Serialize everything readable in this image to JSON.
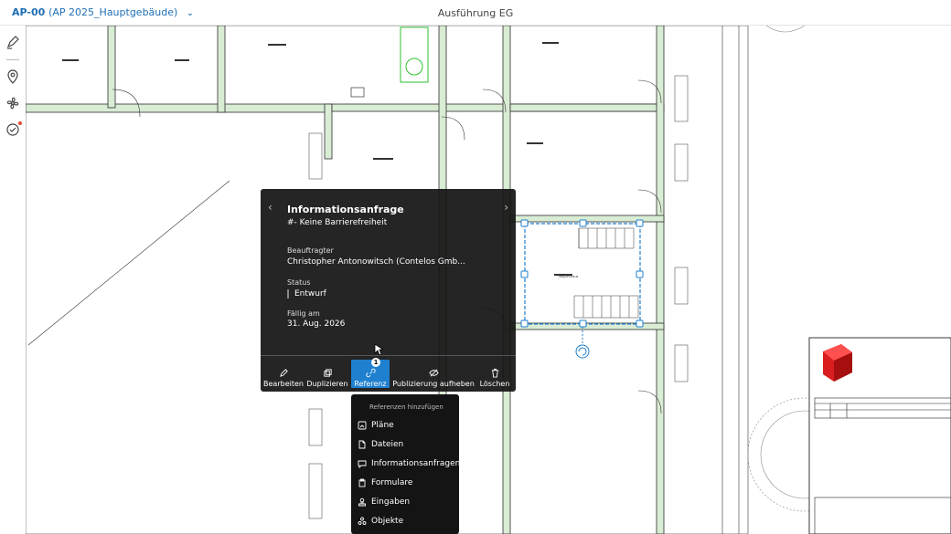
{
  "header": {
    "doc_id": "AP-00",
    "doc_sub": "(AP 2025_Hauptgebäude)",
    "view_title": "Ausführung EG"
  },
  "toolbar": {
    "icons": [
      "markup-pen-icon",
      "location-pin-icon",
      "fan-icon",
      "checklist-icon"
    ]
  },
  "plan": {
    "notation": "Treppenhaus"
  },
  "popup": {
    "title": "Informationsanfrage",
    "subtitle": "#- Keine Barrierefreiheit",
    "assignee_label": "Beauftragter",
    "assignee_value": "Christopher Antonowitsch (Contelos Gmb...",
    "status_label": "Status",
    "status_value": "Entwurf",
    "due_label": "Fällig am",
    "due_value": "31. Aug. 2026",
    "actions": [
      {
        "label": "Bearbeiten",
        "icon": "pencil-icon"
      },
      {
        "label": "Duplizieren",
        "icon": "duplicate-icon"
      },
      {
        "label": "Referenz",
        "icon": "link-icon",
        "badge": "1",
        "active": true
      },
      {
        "label": "Publizierung aufheben",
        "icon": "unpublish-icon"
      },
      {
        "label": "Löschen",
        "icon": "trash-icon"
      }
    ]
  },
  "references_menu": {
    "header": "Referenzen hinzufügen",
    "items": [
      {
        "label": "Pläne",
        "icon": "plan-icon"
      },
      {
        "label": "Dateien",
        "icon": "file-icon"
      },
      {
        "label": "Informationsanfragen",
        "icon": "comment-icon"
      },
      {
        "label": "Formulare",
        "icon": "clipboard-icon"
      },
      {
        "label": "Eingaben",
        "icon": "stamp-icon"
      },
      {
        "label": "Objekte",
        "icon": "objects-icon"
      }
    ]
  },
  "colors": {
    "accent": "#1f80d0",
    "link": "#1f6fb5",
    "wall_fill": "#d9ecd4",
    "selection": "#1f80d0"
  }
}
